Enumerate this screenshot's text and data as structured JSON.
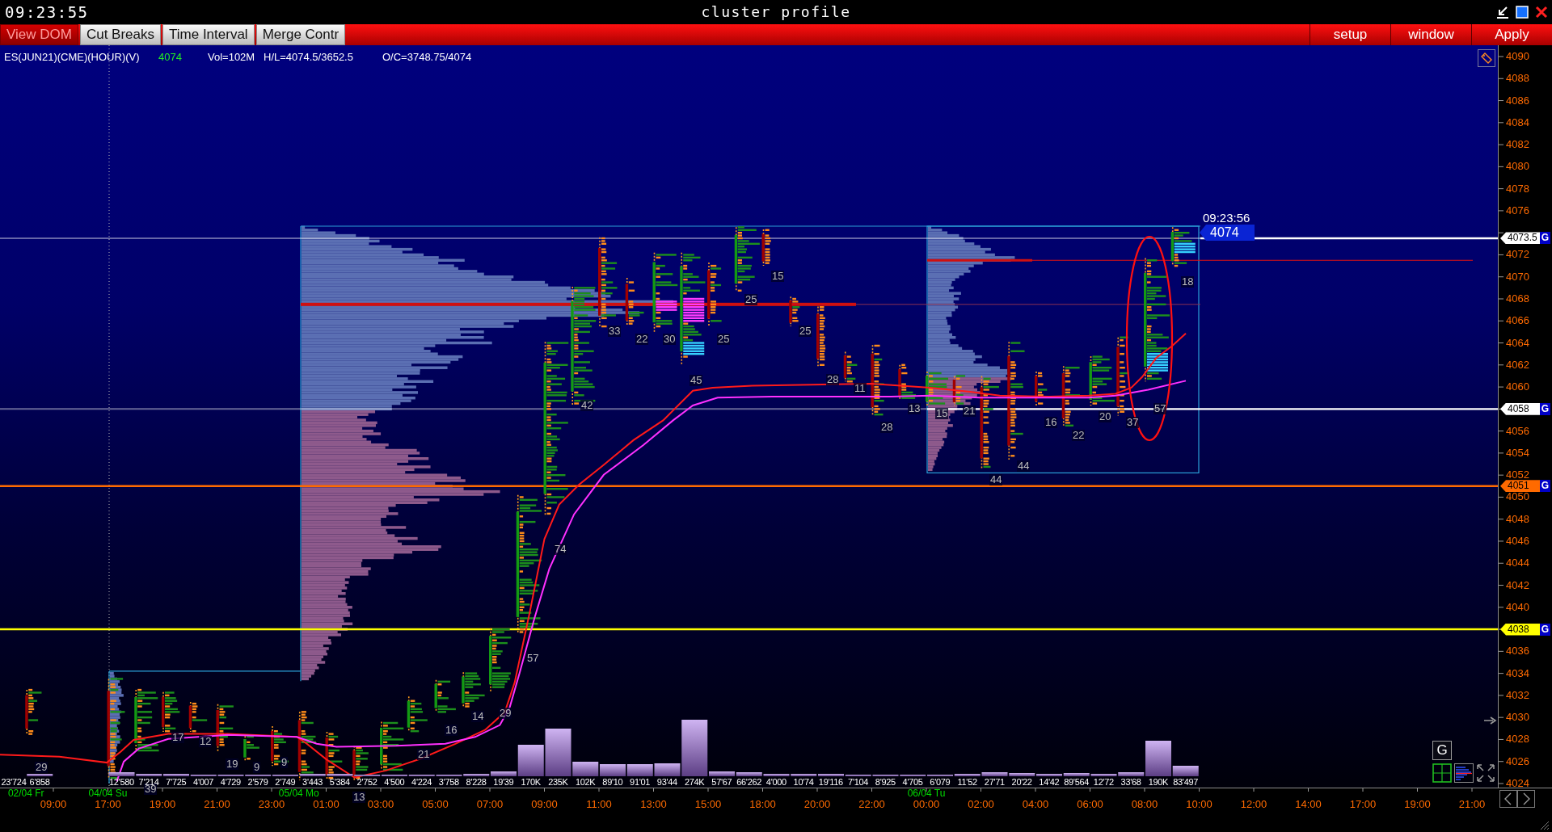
{
  "title_bar": {
    "clock": "09:23:55",
    "title": "cluster profile"
  },
  "toolbar": {
    "left_buttons": [
      {
        "label": "View DOM",
        "active": true
      },
      {
        "label": "Cut Breaks",
        "active": false
      },
      {
        "label": "Time Interval",
        "active": false
      },
      {
        "label": "Merge Contr",
        "active": false
      }
    ],
    "right_buttons": [
      "setup",
      "window",
      "Apply"
    ]
  },
  "chart": {
    "info": {
      "symbol": "ES(JUN21)(CME)(HOUR)(V)",
      "last": "4074",
      "volume": "Vol=102M",
      "high_low": "H/L=4074.5/3652.5",
      "open_close": "O/C=3748.75/4074"
    },
    "last_price": {
      "time": "09:23:56",
      "price": "4074"
    },
    "bar_counts": [
      "29",
      "39",
      "17",
      "12",
      "19",
      "9",
      "9",
      "13",
      "21",
      "16",
      "14",
      "29",
      "57",
      "74",
      "42",
      "33",
      "22",
      "30",
      "45",
      "25",
      "25",
      "15",
      "25",
      "28",
      "11",
      "28",
      "13",
      "15",
      "21",
      "44",
      "44",
      "16",
      "22",
      "20",
      "37",
      "57",
      "18"
    ],
    "volume_labels": [
      "23'724",
      "6'858",
      "12'580",
      "7'214",
      "7'725",
      "4'007",
      "4'729",
      "2'579",
      "2'749",
      "3'443",
      "5'384",
      "2'752",
      "4'500",
      "4'224",
      "3'758",
      "8'228",
      "19'39",
      "170K",
      "235K",
      "102K",
      "89'10",
      "91'01",
      "93'44",
      "274K",
      "57'67",
      "66'262",
      "4'000",
      "10'74",
      "19'116",
      "7'104",
      "8'925",
      "4'705",
      "6'079",
      "11'52",
      "27'71",
      "20'22",
      "14'42",
      "89'564",
      "12'72",
      "33'68",
      "190K",
      "83'497"
    ],
    "mode_button": "G",
    "price_axis": [
      "4090",
      "4088",
      "4086",
      "4084",
      "4082",
      "4080",
      "4078",
      "4076",
      "4072",
      "4070",
      "4068",
      "4066",
      "4064",
      "4062",
      "4060",
      "4056",
      "4054",
      "4052",
      "4050",
      "4048",
      "4046",
      "4044",
      "4042",
      "4040",
      "4036",
      "4034",
      "4032",
      "4030",
      "4028",
      "4026",
      "4024"
    ],
    "level_tags": [
      {
        "price": "4073.5",
        "flag": "G",
        "color": "#ffffff"
      },
      {
        "price": "4058",
        "flag": "G",
        "color": "#ffffff"
      },
      {
        "price": "4051",
        "flag": "G",
        "color": "#ff6a00"
      },
      {
        "price": "4038",
        "flag": "G",
        "color": "#ffff00"
      }
    ],
    "date_labels": [
      "02/04 Fr",
      "04/04 Su",
      "05/04 Mo",
      "06/04 Tu"
    ],
    "time_labels": [
      "09:00",
      "17:00",
      "19:00",
      "21:00",
      "23:00",
      "01:00",
      "03:00",
      "05:00",
      "07:00",
      "09:00",
      "11:00",
      "13:00",
      "15:00",
      "18:00",
      "20:00",
      "22:00",
      "00:00",
      "02:00",
      "04:00",
      "06:00",
      "08:00",
      "10:00",
      "12:00",
      "14:00",
      "17:00",
      "19:00",
      "21:00"
    ]
  }
}
